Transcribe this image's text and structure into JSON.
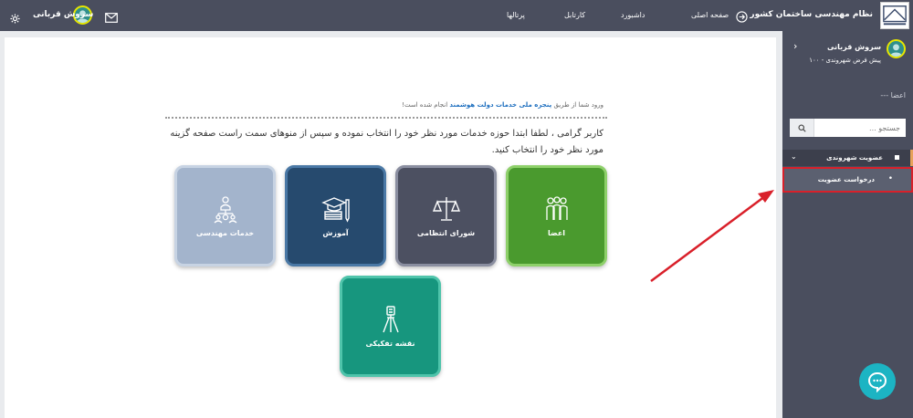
{
  "header": {
    "org_name": "نظام مهندسی ساختمان کشور",
    "nav": [
      "صفحه اصلی",
      "داشبورد",
      "کارتابل",
      "پرتالها"
    ],
    "user_name": "سروش قربانی"
  },
  "sidebar": {
    "user_name": "سروش قربانی",
    "plan": "پیش فرض شهروندی - ۱۰۰",
    "section_title": "--- اعضا",
    "search_placeholder": "جستجو ...",
    "group_label": "عضویت شهروندی",
    "sub_label": "درخواست عضویت"
  },
  "main": {
    "notice_prefix": "ورود شما از طریق",
    "notice_link": "پنجره ملی خدمات دولت هوشمند",
    "notice_suffix": "انجام شده است!",
    "intro": "کاربر گرامی ، لطفا ابتدا حوزه خدمات مورد نظر خود را انتخاب نموده و سپس از منوهای سمت راست صفحه گزینه مورد نظر خود را انتخاب کنید.",
    "tiles": [
      {
        "label": "اعضا",
        "icon": "members-icon",
        "color": "#4a9a2e"
      },
      {
        "label": "شورای انتظامی",
        "icon": "scales-icon",
        "color": "#4c5061"
      },
      {
        "label": "آموزش",
        "icon": "education-icon",
        "color": "#264a6e"
      },
      {
        "label": "خدمات مهندسی",
        "icon": "engineering-services-icon",
        "color": "#a3b4cc"
      },
      {
        "label": "نقشه تفکیکی",
        "icon": "survey-tripod-icon",
        "color": "#17967e"
      }
    ]
  },
  "colors": {
    "topbar": "#4a4e5e",
    "accent_highlight": "#d9202a",
    "chat": "#1cb4c3"
  }
}
